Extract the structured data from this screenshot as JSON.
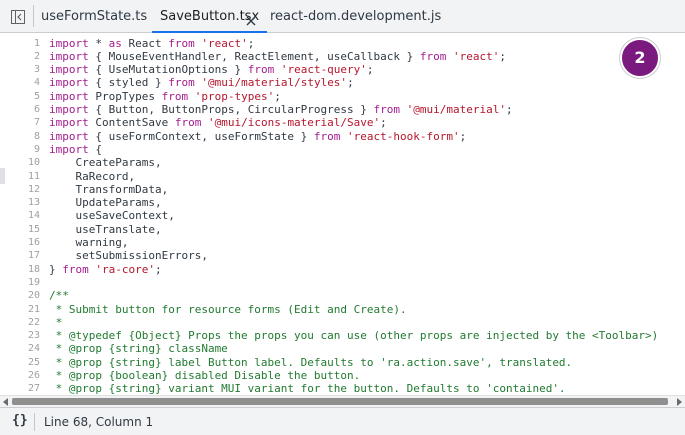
{
  "tabs": [
    {
      "label": "useFormState.ts",
      "active": false
    },
    {
      "label": "SaveButton.tsx",
      "active": true
    },
    {
      "label": "react-dom.development.js",
      "active": false
    }
  ],
  "badge": "2",
  "status": {
    "cursor": "Line 68, Column 1"
  },
  "icons": {
    "panel": "panel-toggle-icon",
    "close": "close-icon",
    "format": "pretty-print-icon"
  },
  "colors": {
    "keyword": "#a31d8d",
    "string": "#b5162d",
    "comment": "#217a30",
    "accent": "#1a73e8",
    "badge": "#7b1a7e"
  },
  "lines": [
    {
      "n": "1",
      "parts": [
        {
          "t": "import",
          "c": "k"
        },
        {
          "t": " * ",
          "c": "p"
        },
        {
          "t": "as",
          "c": "k"
        },
        {
          "t": " React ",
          "c": "p"
        },
        {
          "t": "from",
          "c": "k"
        },
        {
          "t": " ",
          "c": "p"
        },
        {
          "t": "'react'",
          "c": "s"
        },
        {
          "t": ";",
          "c": "p"
        }
      ]
    },
    {
      "n": "2",
      "parts": [
        {
          "t": "import",
          "c": "k"
        },
        {
          "t": " { MouseEventHandler, ReactElement, useCallback } ",
          "c": "p"
        },
        {
          "t": "from",
          "c": "k"
        },
        {
          "t": " ",
          "c": "p"
        },
        {
          "t": "'react'",
          "c": "s"
        },
        {
          "t": ";",
          "c": "p"
        }
      ]
    },
    {
      "n": "3",
      "parts": [
        {
          "t": "import",
          "c": "k"
        },
        {
          "t": " { UseMutationOptions } ",
          "c": "p"
        },
        {
          "t": "from",
          "c": "k"
        },
        {
          "t": " ",
          "c": "p"
        },
        {
          "t": "'react-query'",
          "c": "s"
        },
        {
          "t": ";",
          "c": "p"
        }
      ]
    },
    {
      "n": "4",
      "parts": [
        {
          "t": "import",
          "c": "k"
        },
        {
          "t": " { styled } ",
          "c": "p"
        },
        {
          "t": "from",
          "c": "k"
        },
        {
          "t": " ",
          "c": "p"
        },
        {
          "t": "'@mui/material/styles'",
          "c": "s"
        },
        {
          "t": ";",
          "c": "p"
        }
      ]
    },
    {
      "n": "5",
      "parts": [
        {
          "t": "import",
          "c": "k"
        },
        {
          "t": " PropTypes ",
          "c": "p"
        },
        {
          "t": "from",
          "c": "k"
        },
        {
          "t": " ",
          "c": "p"
        },
        {
          "t": "'prop-types'",
          "c": "s"
        },
        {
          "t": ";",
          "c": "p"
        }
      ]
    },
    {
      "n": "6",
      "parts": [
        {
          "t": "import",
          "c": "k"
        },
        {
          "t": " { Button, ButtonProps, CircularProgress } ",
          "c": "p"
        },
        {
          "t": "from",
          "c": "k"
        },
        {
          "t": " ",
          "c": "p"
        },
        {
          "t": "'@mui/material'",
          "c": "s"
        },
        {
          "t": ";",
          "c": "p"
        }
      ]
    },
    {
      "n": "7",
      "parts": [
        {
          "t": "import",
          "c": "k"
        },
        {
          "t": " ContentSave ",
          "c": "p"
        },
        {
          "t": "from",
          "c": "k"
        },
        {
          "t": " ",
          "c": "p"
        },
        {
          "t": "'@mui/icons-material/Save'",
          "c": "s"
        },
        {
          "t": ";",
          "c": "p"
        }
      ]
    },
    {
      "n": "8",
      "parts": [
        {
          "t": "import",
          "c": "k"
        },
        {
          "t": " { useFormContext, useFormState } ",
          "c": "p"
        },
        {
          "t": "from",
          "c": "k"
        },
        {
          "t": " ",
          "c": "p"
        },
        {
          "t": "'react-hook-form'",
          "c": "s"
        },
        {
          "t": ";",
          "c": "p"
        }
      ]
    },
    {
      "n": "9",
      "parts": [
        {
          "t": "import",
          "c": "k"
        },
        {
          "t": " {",
          "c": "p"
        }
      ]
    },
    {
      "n": "10",
      "parts": [
        {
          "t": "    CreateParams,",
          "c": "p"
        }
      ]
    },
    {
      "n": "11",
      "parts": [
        {
          "t": "    RaRecord,",
          "c": "p"
        }
      ]
    },
    {
      "n": "12",
      "parts": [
        {
          "t": "    TransformData,",
          "c": "p"
        }
      ]
    },
    {
      "n": "13",
      "parts": [
        {
          "t": "    UpdateParams,",
          "c": "p"
        }
      ]
    },
    {
      "n": "14",
      "parts": [
        {
          "t": "    useSaveContext,",
          "c": "p"
        }
      ]
    },
    {
      "n": "15",
      "parts": [
        {
          "t": "    useTranslate,",
          "c": "p"
        }
      ]
    },
    {
      "n": "16",
      "parts": [
        {
          "t": "    warning,",
          "c": "p"
        }
      ]
    },
    {
      "n": "17",
      "parts": [
        {
          "t": "    setSubmissionErrors,",
          "c": "p"
        }
      ]
    },
    {
      "n": "18",
      "parts": [
        {
          "t": "} ",
          "c": "p"
        },
        {
          "t": "from",
          "c": "k"
        },
        {
          "t": " ",
          "c": "p"
        },
        {
          "t": "'ra-core'",
          "c": "s"
        },
        {
          "t": ";",
          "c": "p"
        }
      ]
    },
    {
      "n": "19",
      "parts": []
    },
    {
      "n": "20",
      "parts": [
        {
          "t": "/**",
          "c": "c"
        }
      ]
    },
    {
      "n": "21",
      "parts": [
        {
          "t": " * Submit button for resource forms (Edit and Create).",
          "c": "c"
        }
      ]
    },
    {
      "n": "22",
      "parts": [
        {
          "t": " *",
          "c": "c"
        }
      ]
    },
    {
      "n": "23",
      "parts": [
        {
          "t": " * @typedef {Object} Props the props you can use (other props are injected by the <Toolbar>)",
          "c": "c"
        }
      ]
    },
    {
      "n": "24",
      "parts": [
        {
          "t": " * @prop {string} className",
          "c": "c"
        }
      ]
    },
    {
      "n": "25",
      "parts": [
        {
          "t": " * @prop {string} label Button label. Defaults to 'ra.action.save', translated.",
          "c": "c"
        }
      ]
    },
    {
      "n": "26",
      "parts": [
        {
          "t": " * @prop {boolean} disabled Disable the button.",
          "c": "c"
        }
      ]
    },
    {
      "n": "27",
      "parts": [
        {
          "t": " * @prop {string} variant MUI variant for the button. Defaults to 'contained'.",
          "c": "c"
        }
      ]
    }
  ]
}
